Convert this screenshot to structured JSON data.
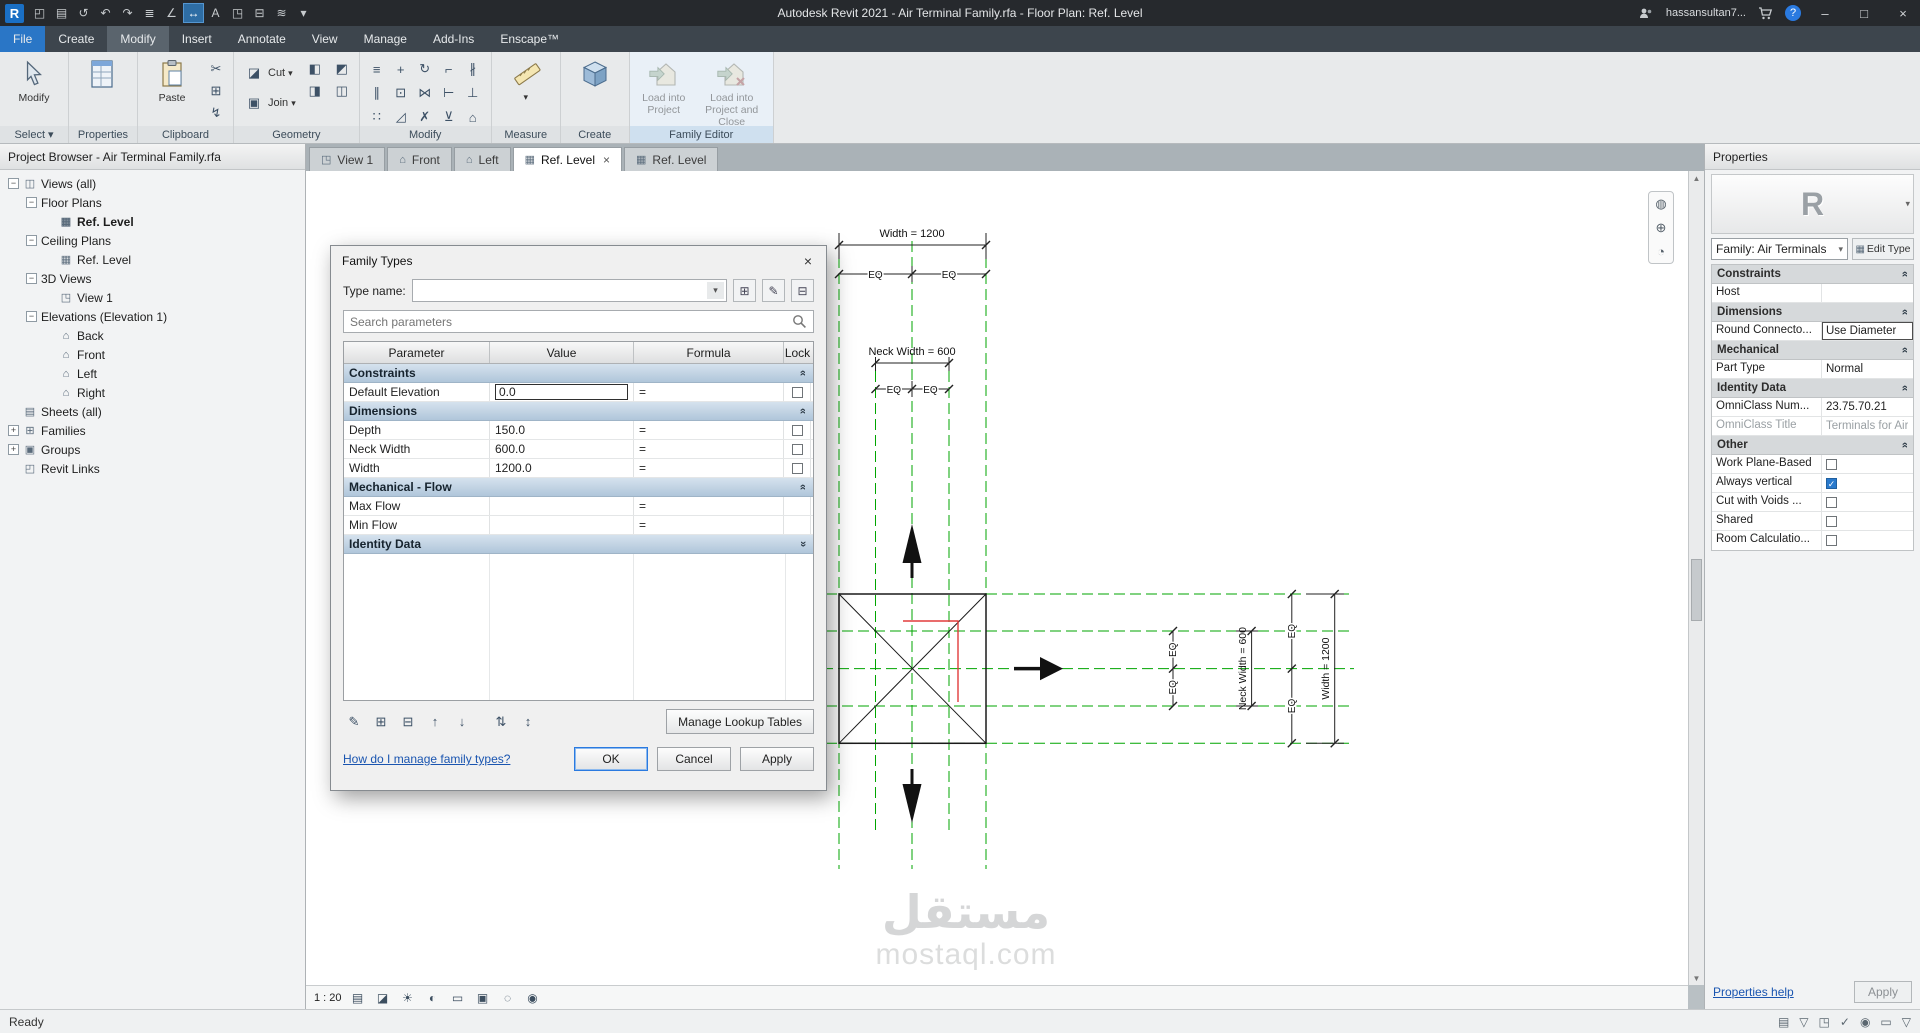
{
  "titlebar": {
    "title": "Autodesk Revit 2021 - Air Terminal Family.rfa - Floor Plan: Ref. Level",
    "user": "hassansultan7..."
  },
  "menu": {
    "file": "File",
    "tabs": [
      "Create",
      "Modify",
      "Insert",
      "Annotate",
      "View",
      "Manage",
      "Add-Ins",
      "Enscape™"
    ]
  },
  "ribbon": {
    "modify": "Modify",
    "paste": "Paste",
    "cut": "Cut",
    "join": "Join",
    "load_project": "Load into Project",
    "load_close": "Load into Project and Close",
    "p_select": "Select",
    "p_properties": "Properties",
    "p_clipboard": "Clipboard",
    "p_geometry": "Geometry",
    "p_modify": "Modify",
    "p_measure": "Measure",
    "p_create": "Create",
    "p_family": "Family Editor"
  },
  "browser": {
    "title": "Project Browser - Air Terminal Family.rfa",
    "items": [
      "Views (all)",
      "Floor Plans",
      "Ref. Level",
      "Ceiling Plans",
      "Ref. Level",
      "3D Views",
      "View 1",
      "Elevations (Elevation 1)",
      "Back",
      "Front",
      "Left",
      "Right",
      "Sheets (all)",
      "Families",
      "Groups",
      "Revit Links"
    ]
  },
  "tabs": {
    "t0": "View 1",
    "t1": "Front",
    "t2": "Left",
    "t3": "Ref. Level",
    "t4": "Ref. Level"
  },
  "dialog": {
    "title": "Family Types",
    "type_name_label": "Type name:",
    "search_placeholder": "Search parameters",
    "col_parameter": "Parameter",
    "col_value": "Value",
    "col_formula": "Formula",
    "col_lock": "Lock",
    "sec_constraints": "Constraints",
    "sec_dimensions": "Dimensions",
    "sec_mechanical": "Mechanical - Flow",
    "sec_identity": "Identity Data",
    "rows": {
      "default_elevation": {
        "p": "Default Elevation",
        "v": "0.0"
      },
      "depth": {
        "p": "Depth",
        "v": "150.0"
      },
      "neck_width": {
        "p": "Neck Width",
        "v": "600.0"
      },
      "width": {
        "p": "Width",
        "v": "1200.0"
      },
      "max_flow": {
        "p": "Max Flow"
      },
      "min_flow": {
        "p": "Min Flow"
      }
    },
    "formula_eq": "=",
    "manage_lookup": "Manage Lookup Tables",
    "help_link": "How do I manage family types?",
    "ok": "OK",
    "cancel": "Cancel",
    "apply": "Apply"
  },
  "canvas": {
    "dim_width_top": "Width = 1200",
    "dim_neck_top": "Neck Width = 600",
    "dim_neck_right": "Neck Width = 600",
    "dim_width_right": "Width = 1200",
    "eq": "EQ",
    "scale": "1 : 20",
    "watermark_ar": "مستقل",
    "watermark_en": "mostaql.com"
  },
  "props": {
    "header": "Properties",
    "preview_logo": "R",
    "family": "Family: Air Terminals",
    "edit_type": "Edit Type",
    "g_constraints": "Constraints",
    "r_host": "Host",
    "g_dimensions": "Dimensions",
    "r_round": "Round Connecto...",
    "v_round": "Use Diameter",
    "g_mechanical": "Mechanical",
    "r_part_type": "Part Type",
    "v_part_type": "Normal",
    "g_identity": "Identity Data",
    "r_omni_num": "OmniClass Num...",
    "v_omni_num": "23.75.70.21",
    "r_omni_title": "OmniClass Title",
    "v_omni_title": "Terminals for Air",
    "g_other": "Other",
    "r_work_plane": "Work Plane-Based",
    "r_always_vertical": "Always vertical",
    "r_cut_voids": "Cut with Voids ...",
    "r_shared": "Shared",
    "r_room_calc": "Room Calculatio...",
    "help": "Properties help",
    "apply": "Apply"
  },
  "status": {
    "ready": "Ready"
  },
  "icons": {
    "logo": "R",
    "open": "◰",
    "save": "▤",
    "sync": "↺",
    "undo": "↶",
    "redo": "↷",
    "print": "≣",
    "measure_tool": "∠",
    "dimension": "↔",
    "text_tool": "A",
    "view_3d": "◳",
    "section": "⊟",
    "thin_lines": "≋",
    "dropdown": "▾",
    "minimize": "–",
    "maximize": "□",
    "close": "×",
    "cut_small": "✂",
    "copy_small": "⊞",
    "match_small": "↯",
    "cut_geo": "◪",
    "join_geo": "▣",
    "paint": "◧",
    "cope": "◨",
    "wall_join": "◩",
    "beam": "◫",
    "align": "≡",
    "move": "+",
    "rotate": "↻",
    "trim": "⌐",
    "split": "∦",
    "offset": "∥",
    "copy": "⊡",
    "mirror": "⋈",
    "extend": "⊢",
    "pin": "⊥",
    "array": "∷",
    "scale": "◿",
    "delete": "✗",
    "unpin": "⊻",
    "match": "⌂",
    "tree_minus": "−",
    "tree_plus": "+",
    "tree_views": "◫",
    "tree_plan": "▦",
    "tree_3d": "◳",
    "tree_elev": "⌂",
    "tree_sheet": "▤",
    "tree_family": "⊞",
    "tree_group": "▣",
    "tree_link": "◰",
    "tab_plan": "▦",
    "tab_3d": "◳",
    "tab_elev": "⌂",
    "chevrons": "»",
    "check": "✓",
    "pencil": "✎",
    "new_param": "⊞",
    "del_param": "⊟",
    "up": "↑",
    "down": "↓",
    "sort_asc": "⇅",
    "sort_desc": "↕",
    "wheel": "◍",
    "zoom_pan": "⊕",
    "orbit": "◔",
    "detail": "▤",
    "style": "◪",
    "sun": "☀",
    "shadow": "◐",
    "crop": "▭",
    "crop_vis": "▣",
    "hide": "◌",
    "reveal": "◉",
    "scroll_up": "▲",
    "scroll_down": "▼",
    "sb1": "▤",
    "sb2": "▽",
    "sb3": "◳",
    "sb4": "✓",
    "sb5": "◉",
    "sb6": "▭"
  }
}
